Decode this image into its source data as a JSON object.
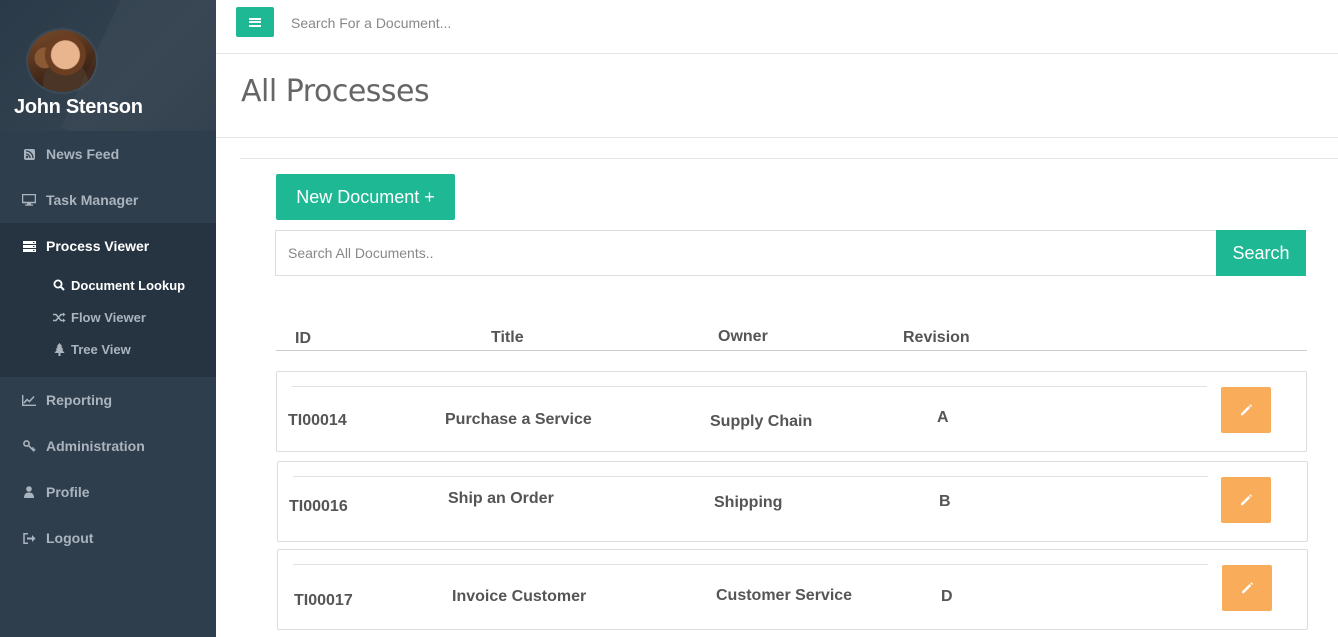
{
  "sidebar": {
    "user_name": "John Stenson",
    "nav": [
      {
        "label": "News Feed",
        "icon": "rss-icon"
      },
      {
        "label": "Task Manager",
        "icon": "desktop-icon"
      },
      {
        "label": "Process Viewer",
        "icon": "server-icon"
      },
      {
        "label": "Reporting",
        "icon": "line-chart-icon"
      },
      {
        "label": "Administration",
        "icon": "key-icon"
      },
      {
        "label": "Profile",
        "icon": "user-icon"
      },
      {
        "label": "Logout",
        "icon": "sign-out-icon"
      }
    ],
    "sub_nav": [
      {
        "label": "Document Lookup",
        "icon": "search-icon"
      },
      {
        "label": "Flow Viewer",
        "icon": "random-icon"
      },
      {
        "label": "Tree View",
        "icon": "tree-icon"
      }
    ]
  },
  "topbar": {
    "search_placeholder": "Search For a Document..."
  },
  "page": {
    "title": "All Processes",
    "new_document_label": "New Document +",
    "search_placeholder": "Search All Documents..",
    "search_button_label": "Search"
  },
  "table": {
    "columns": [
      "ID",
      "Title",
      "Owner",
      "Revision"
    ],
    "rows": [
      {
        "id": "TI00014",
        "title": "Purchase a Service",
        "owner": "Supply Chain",
        "revision": "A"
      },
      {
        "id": "TI00016",
        "title": "Ship an Order",
        "owner": "Shipping",
        "revision": "B"
      },
      {
        "id": "TI00017",
        "title": "Invoice Customer",
        "owner": "Customer Service",
        "revision": "D"
      }
    ]
  },
  "colors": {
    "accent": "#1fb894",
    "edit": "#f9ad5a",
    "sidebar": "#2f3e4d"
  }
}
